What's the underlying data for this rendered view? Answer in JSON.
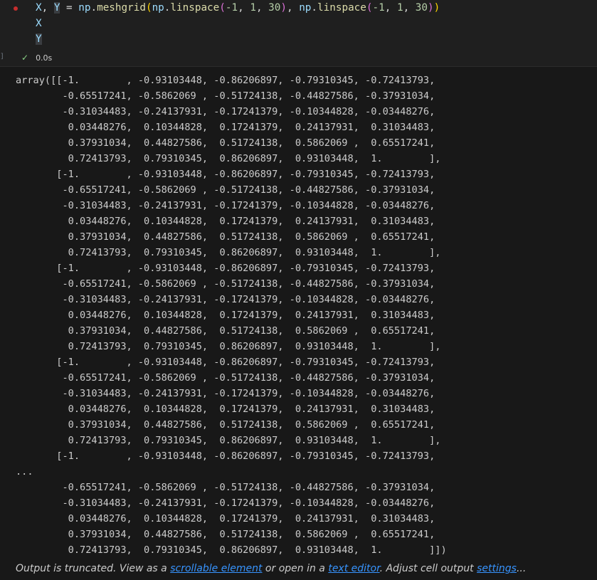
{
  "cell": {
    "gutter_label": "]",
    "code": {
      "l1_x": "X",
      "l1_comma": ", ",
      "l1_y": "Y",
      "l1_eq": " = ",
      "l1_np1": "np",
      "l1_dot1": ".",
      "l1_fn1": "meshgrid",
      "l1_p1": "(",
      "l1_np2": "np",
      "l1_dot2": ".",
      "l1_fn2": "linspace",
      "l1_p2": "(",
      "l1_a1": "-1",
      "l1_c1": ", ",
      "l1_a2": "1",
      "l1_c2": ", ",
      "l1_a3": "30",
      "l1_p3": ")",
      "l1_c3": ", ",
      "l1_np3": "np",
      "l1_dot3": ".",
      "l1_fn3": "linspace",
      "l1_p4": "(",
      "l1_a4": "-1",
      "l1_c4": ", ",
      "l1_a5": "1",
      "l1_c5": ", ",
      "l1_a6": "30",
      "l1_p5": ")",
      "l1_p6": ")",
      "line2": "X",
      "line3": "Y"
    },
    "status": {
      "check": "✓",
      "duration": "0.0s"
    }
  },
  "output": {
    "text": "array([[-1.        , -0.93103448, -0.86206897, -0.79310345, -0.72413793,\n        -0.65517241, -0.5862069 , -0.51724138, -0.44827586, -0.37931034,\n        -0.31034483, -0.24137931, -0.17241379, -0.10344828, -0.03448276,\n         0.03448276,  0.10344828,  0.17241379,  0.24137931,  0.31034483,\n         0.37931034,  0.44827586,  0.51724138,  0.5862069 ,  0.65517241,\n         0.72413793,  0.79310345,  0.86206897,  0.93103448,  1.        ],\n       [-1.        , -0.93103448, -0.86206897, -0.79310345, -0.72413793,\n        -0.65517241, -0.5862069 , -0.51724138, -0.44827586, -0.37931034,\n        -0.31034483, -0.24137931, -0.17241379, -0.10344828, -0.03448276,\n         0.03448276,  0.10344828,  0.17241379,  0.24137931,  0.31034483,\n         0.37931034,  0.44827586,  0.51724138,  0.5862069 ,  0.65517241,\n         0.72413793,  0.79310345,  0.86206897,  0.93103448,  1.        ],\n       [-1.        , -0.93103448, -0.86206897, -0.79310345, -0.72413793,\n        -0.65517241, -0.5862069 , -0.51724138, -0.44827586, -0.37931034,\n        -0.31034483, -0.24137931, -0.17241379, -0.10344828, -0.03448276,\n         0.03448276,  0.10344828,  0.17241379,  0.24137931,  0.31034483,\n         0.37931034,  0.44827586,  0.51724138,  0.5862069 ,  0.65517241,\n         0.72413793,  0.79310345,  0.86206897,  0.93103448,  1.        ],\n       [-1.        , -0.93103448, -0.86206897, -0.79310345, -0.72413793,\n        -0.65517241, -0.5862069 , -0.51724138, -0.44827586, -0.37931034,\n        -0.31034483, -0.24137931, -0.17241379, -0.10344828, -0.03448276,\n         0.03448276,  0.10344828,  0.17241379,  0.24137931,  0.31034483,\n         0.37931034,  0.44827586,  0.51724138,  0.5862069 ,  0.65517241,\n         0.72413793,  0.79310345,  0.86206897,  0.93103448,  1.        ],\n       [-1.        , -0.93103448, -0.86206897, -0.79310345, -0.72413793,\n...\n        -0.65517241, -0.5862069 , -0.51724138, -0.44827586, -0.37931034,\n        -0.31034483, -0.24137931, -0.17241379, -0.10344828, -0.03448276,\n         0.03448276,  0.10344828,  0.17241379,  0.24137931,  0.31034483,\n         0.37931034,  0.44827586,  0.51724138,  0.5862069 ,  0.65517241,\n         0.72413793,  0.79310345,  0.86206897,  0.93103448,  1.        ]])",
    "truncated": {
      "prefix": "Output is truncated. View as a ",
      "scrollable_link": "scrollable element",
      "middle": " or open in a ",
      "editor_link": "text editor",
      "suffix": ". Adjust cell output ",
      "settings_link": "settings",
      "ellipsis": "..."
    }
  },
  "colors": {
    "background": "#1f1f1f",
    "output_background": "#181818",
    "variable": "#9cdcfe",
    "function": "#dcdcaa",
    "number": "#b5cea8",
    "bracket_1": "#ffd700",
    "bracket_2": "#da70d6",
    "link": "#3794ff",
    "success": "#89d185",
    "error_dot": "#c72e2e"
  }
}
